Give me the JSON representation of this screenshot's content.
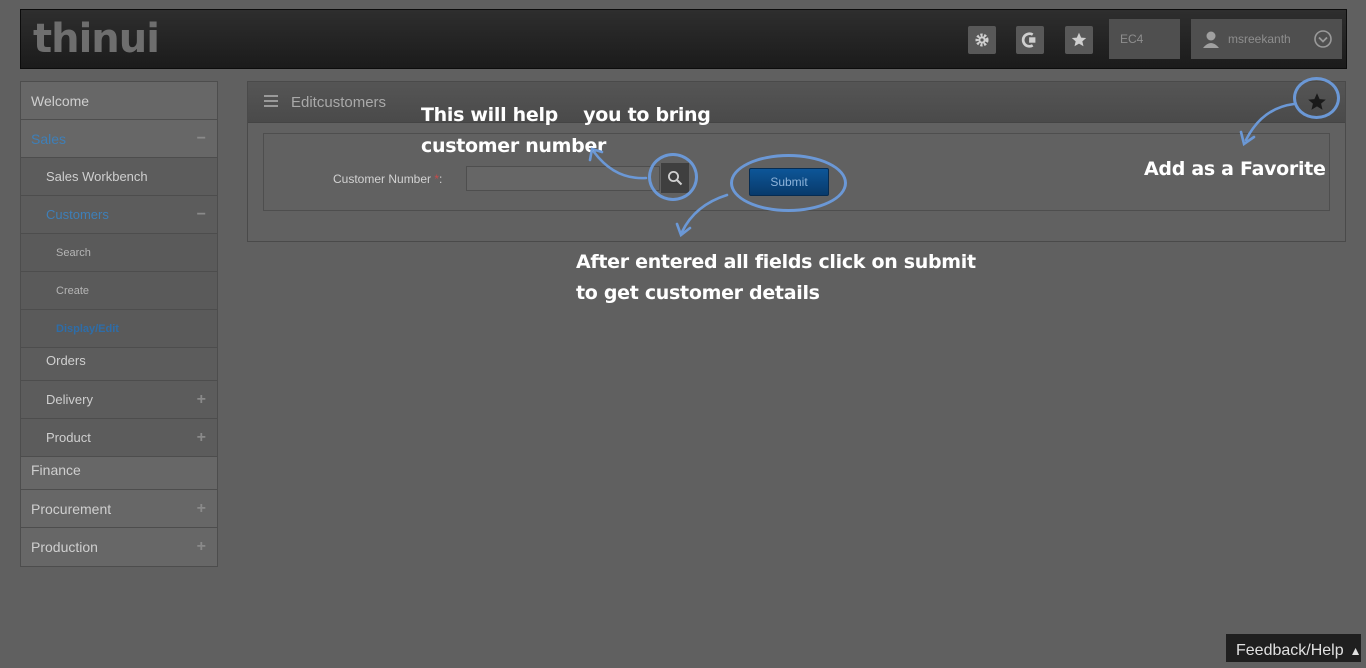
{
  "header": {
    "logo": "thinui",
    "client": "EC4",
    "username": "msreekanth"
  },
  "sidebar": {
    "items": [
      {
        "label": "Welcome"
      },
      {
        "label": "Sales",
        "sign": "−"
      },
      {
        "label": "Sales Workbench"
      },
      {
        "label": "Customers",
        "sign": "−"
      },
      {
        "label": "Search"
      },
      {
        "label": "Create"
      },
      {
        "label": "Display/Edit"
      },
      {
        "label": "Orders"
      },
      {
        "label": "Delivery",
        "sign": "+"
      },
      {
        "label": "Product",
        "sign": "+"
      },
      {
        "label": "Finance"
      },
      {
        "label": "Procurement",
        "sign": "+"
      },
      {
        "label": "Production",
        "sign": "+"
      }
    ]
  },
  "main": {
    "title": "Editcustomers",
    "form": {
      "customer_number_label": "Customer Number",
      "required_mark": "*",
      "colon": ":",
      "customer_number_value": "",
      "submit_label": "Submit"
    }
  },
  "annotations": {
    "search_help_line1": "This will help    you to bring",
    "search_help_line2": "customer number",
    "favorite_help": "Add as a Favorite",
    "submit_help_line1": "After entered all fields click on submit",
    "submit_help_line2": "to get customer details"
  },
  "footer": {
    "feedback": "Feedback/Help"
  },
  "colors": {
    "accent_ring": "#6b98d6",
    "submit_blue": "#0d5698",
    "active_nav": "#3e7fb8"
  },
  "icons": [
    "settings-icon",
    "transaction-icon",
    "favorites-icon",
    "user-icon",
    "chevron-down-icon",
    "menu-icon",
    "star-icon",
    "search-icon"
  ]
}
